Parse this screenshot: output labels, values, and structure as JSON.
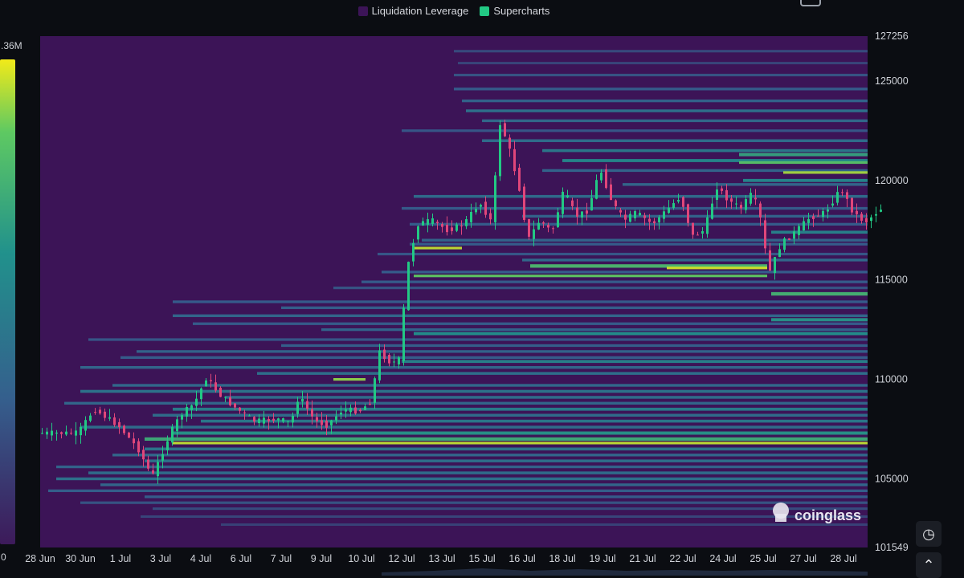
{
  "legend": {
    "items": [
      {
        "label": "Liquidation Leverage",
        "color": "#3c1457"
      },
      {
        "label": "Supercharts",
        "color": "#22c984"
      }
    ]
  },
  "watermark": "coinglass",
  "colorscale": {
    "max_label": ".36M",
    "min_label": "0"
  },
  "chart_data": {
    "type": "heatmap",
    "title": "",
    "xlabel": "",
    "ylabel": "",
    "x_tick_labels": [
      "28 Jun",
      "30 Jun",
      "1 Jul",
      "3 Jul",
      "4 Jul",
      "6 Jul",
      "7 Jul",
      "9 Jul",
      "10 Jul",
      "12 Jul",
      "13 Jul",
      "15 Jul",
      "16 Jul",
      "18 Jul",
      "19 Jul",
      "21 Jul",
      "22 Jul",
      "24 Jul",
      "25 Jul",
      "27 Jul",
      "28 Jul"
    ],
    "y_tick_labels": [
      "127256",
      "125000",
      "120000",
      "115000",
      "110000",
      "105000",
      "101549"
    ],
    "ylim": [
      101549,
      127256
    ],
    "legend_placement": "top-center",
    "series": [
      {
        "name": "Liquidation Leverage",
        "kind": "heatmap"
      },
      {
        "name": "Supercharts",
        "kind": "candlestick"
      }
    ],
    "price_path": [
      {
        "t": 0.0,
        "p": 107300
      },
      {
        "t": 1.0,
        "p": 107300
      },
      {
        "t": 1.4,
        "p": 108500
      },
      {
        "t": 2.0,
        "p": 107700
      },
      {
        "t": 2.5,
        "p": 106500
      },
      {
        "t": 2.85,
        "p": 105100
      },
      {
        "t": 3.3,
        "p": 107300
      },
      {
        "t": 3.55,
        "p": 108200
      },
      {
        "t": 3.9,
        "p": 108800
      },
      {
        "t": 4.2,
        "p": 110100
      },
      {
        "t": 4.5,
        "p": 109300
      },
      {
        "t": 4.9,
        "p": 108600
      },
      {
        "t": 5.4,
        "p": 107900
      },
      {
        "t": 6.0,
        "p": 108000
      },
      {
        "t": 6.3,
        "p": 107800
      },
      {
        "t": 6.5,
        "p": 109200
      },
      {
        "t": 6.9,
        "p": 107900
      },
      {
        "t": 7.2,
        "p": 107700
      },
      {
        "t": 7.6,
        "p": 108500
      },
      {
        "t": 8.0,
        "p": 108400
      },
      {
        "t": 8.3,
        "p": 108900
      },
      {
        "t": 8.5,
        "p": 111400
      },
      {
        "t": 8.8,
        "p": 110800
      },
      {
        "t": 9.0,
        "p": 111000
      },
      {
        "t": 9.2,
        "p": 115600
      },
      {
        "t": 9.45,
        "p": 117800
      },
      {
        "t": 9.8,
        "p": 118000
      },
      {
        "t": 10.2,
        "p": 117500
      },
      {
        "t": 10.6,
        "p": 117800
      },
      {
        "t": 11.0,
        "p": 118900
      },
      {
        "t": 11.3,
        "p": 117900
      },
      {
        "t": 11.5,
        "p": 122900
      },
      {
        "t": 11.7,
        "p": 121900
      },
      {
        "t": 12.0,
        "p": 119500
      },
      {
        "t": 12.2,
        "p": 117000
      },
      {
        "t": 12.5,
        "p": 118000
      },
      {
        "t": 12.8,
        "p": 117400
      },
      {
        "t": 13.1,
        "p": 119500
      },
      {
        "t": 13.4,
        "p": 118200
      },
      {
        "t": 13.7,
        "p": 118500
      },
      {
        "t": 14.0,
        "p": 120600
      },
      {
        "t": 14.3,
        "p": 118900
      },
      {
        "t": 14.6,
        "p": 118000
      },
      {
        "t": 14.9,
        "p": 118400
      },
      {
        "t": 15.3,
        "p": 117800
      },
      {
        "t": 15.7,
        "p": 118600
      },
      {
        "t": 16.0,
        "p": 119200
      },
      {
        "t": 16.3,
        "p": 117200
      },
      {
        "t": 16.6,
        "p": 117500
      },
      {
        "t": 16.9,
        "p": 119700
      },
      {
        "t": 17.2,
        "p": 119000
      },
      {
        "t": 17.5,
        "p": 118600
      },
      {
        "t": 17.8,
        "p": 119400
      },
      {
        "t": 18.0,
        "p": 118000
      },
      {
        "t": 18.2,
        "p": 115300
      },
      {
        "t": 18.5,
        "p": 116800
      },
      {
        "t": 18.8,
        "p": 117300
      },
      {
        "t": 19.2,
        "p": 118100
      },
      {
        "t": 19.6,
        "p": 118400
      },
      {
        "t": 20.0,
        "p": 119600
      },
      {
        "t": 20.3,
        "p": 118400
      },
      {
        "t": 20.6,
        "p": 117900
      },
      {
        "t": 21.0,
        "p": 118600
      }
    ],
    "liquidation_bands": [
      {
        "y": 126500,
        "start": 10.3,
        "intensity": 0.22
      },
      {
        "y": 125900,
        "start": 10.4,
        "intensity": 0.2
      },
      {
        "y": 125300,
        "start": 10.3,
        "intensity": 0.26
      },
      {
        "y": 124600,
        "start": 10.3,
        "intensity": 0.3
      },
      {
        "y": 124000,
        "start": 10.5,
        "intensity": 0.34
      },
      {
        "y": 123500,
        "start": 10.6,
        "intensity": 0.42
      },
      {
        "y": 123000,
        "start": 11.0,
        "intensity": 0.38
      },
      {
        "y": 122500,
        "start": 9.0,
        "intensity": 0.28
      },
      {
        "y": 122000,
        "start": 11.0,
        "intensity": 0.4
      },
      {
        "y": 121500,
        "start": 12.5,
        "intensity": 0.46
      },
      {
        "y": 121300,
        "start": 17.4,
        "intensity": 0.68
      },
      {
        "y": 121000,
        "start": 13.0,
        "intensity": 0.55
      },
      {
        "y": 120900,
        "start": 17.4,
        "intensity": 0.82
      },
      {
        "y": 120500,
        "start": 12.5,
        "intensity": 0.35
      },
      {
        "y": 120400,
        "start": 18.5,
        "intensity": 0.92
      },
      {
        "y": 120000,
        "start": 17.5,
        "intensity": 0.55
      },
      {
        "y": 119800,
        "start": 14.5,
        "intensity": 0.36
      },
      {
        "y": 119200,
        "start": 9.3,
        "intensity": 0.4
      },
      {
        "y": 118600,
        "start": 9.0,
        "intensity": 0.3
      },
      {
        "y": 118200,
        "start": 12.0,
        "intensity": 0.34
      },
      {
        "y": 117800,
        "start": 9.2,
        "intensity": 0.3
      },
      {
        "y": 117400,
        "start": 18.2,
        "intensity": 0.52
      },
      {
        "y": 117000,
        "start": 9.5,
        "intensity": 0.35
      },
      {
        "y": 116800,
        "start": 9.2,
        "intensity": 0.3
      },
      {
        "y": 116600,
        "start": 9.3,
        "end": 10.5,
        "intensity": 0.95
      },
      {
        "y": 116300,
        "start": 8.4,
        "intensity": 0.28
      },
      {
        "y": 116000,
        "start": 12.0,
        "intensity": 0.38
      },
      {
        "y": 115700,
        "start": 12.2,
        "end": 18.1,
        "intensity": 0.78
      },
      {
        "y": 115600,
        "start": 15.6,
        "end": 18.1,
        "intensity": 0.97
      },
      {
        "y": 115400,
        "start": 8.5,
        "intensity": 0.3
      },
      {
        "y": 115200,
        "start": 9.3,
        "end": 18.1,
        "intensity": 0.85
      },
      {
        "y": 114900,
        "start": 8.0,
        "intensity": 0.3
      },
      {
        "y": 114600,
        "start": 7.3,
        "intensity": 0.26
      },
      {
        "y": 114300,
        "start": 18.2,
        "intensity": 0.75
      },
      {
        "y": 113900,
        "start": 3.3,
        "intensity": 0.3
      },
      {
        "y": 113600,
        "start": 6.0,
        "intensity": 0.32
      },
      {
        "y": 113200,
        "start": 3.3,
        "intensity": 0.36
      },
      {
        "y": 113000,
        "start": 18.2,
        "intensity": 0.62
      },
      {
        "y": 112800,
        "start": 3.8,
        "intensity": 0.3
      },
      {
        "y": 112500,
        "start": 7.0,
        "intensity": 0.34
      },
      {
        "y": 112300,
        "start": 9.3,
        "intensity": 0.6
      },
      {
        "y": 112000,
        "start": 1.2,
        "intensity": 0.28
      },
      {
        "y": 111700,
        "start": 6.0,
        "intensity": 0.32
      },
      {
        "y": 111400,
        "start": 2.4,
        "intensity": 0.34
      },
      {
        "y": 111100,
        "start": 2.0,
        "intensity": 0.3
      },
      {
        "y": 110900,
        "start": 9.0,
        "intensity": 0.52
      },
      {
        "y": 110600,
        "start": 1.0,
        "intensity": 0.36
      },
      {
        "y": 110300,
        "start": 5.4,
        "intensity": 0.42
      },
      {
        "y": 110000,
        "start": 7.3,
        "end": 8.1,
        "intensity": 0.9
      },
      {
        "y": 109700,
        "start": 1.8,
        "intensity": 0.38
      },
      {
        "y": 109400,
        "start": 1.0,
        "intensity": 0.44
      },
      {
        "y": 109100,
        "start": 4.6,
        "intensity": 0.4
      },
      {
        "y": 108800,
        "start": 0.6,
        "intensity": 0.36
      },
      {
        "y": 108500,
        "start": 3.3,
        "intensity": 0.5
      },
      {
        "y": 108200,
        "start": 2.8,
        "intensity": 0.4
      },
      {
        "y": 107900,
        "start": 4.0,
        "intensity": 0.46
      },
      {
        "y": 107600,
        "start": 1.0,
        "intensity": 0.4
      },
      {
        "y": 107300,
        "start": 3.3,
        "intensity": 0.62
      },
      {
        "y": 107000,
        "start": 2.6,
        "intensity": 0.72
      },
      {
        "y": 106800,
        "start": 3.3,
        "intensity": 0.95
      },
      {
        "y": 106500,
        "start": 2.6,
        "intensity": 0.45
      },
      {
        "y": 106200,
        "start": 1.8,
        "intensity": 0.36
      },
      {
        "y": 105900,
        "start": 2.6,
        "intensity": 0.42
      },
      {
        "y": 105600,
        "start": 0.4,
        "intensity": 0.34
      },
      {
        "y": 105300,
        "start": 1.2,
        "intensity": 0.4
      },
      {
        "y": 105000,
        "start": 0.4,
        "intensity": 0.42
      },
      {
        "y": 104700,
        "start": 1.5,
        "intensity": 0.36
      },
      {
        "y": 104400,
        "start": 0.2,
        "intensity": 0.32
      },
      {
        "y": 104100,
        "start": 2.6,
        "intensity": 0.3
      },
      {
        "y": 103800,
        "start": 1.0,
        "intensity": 0.26
      },
      {
        "y": 103500,
        "start": 2.8,
        "intensity": 0.22
      },
      {
        "y": 103100,
        "start": 2.5,
        "intensity": 0.2
      },
      {
        "y": 102700,
        "start": 4.5,
        "intensity": 0.18
      }
    ]
  }
}
